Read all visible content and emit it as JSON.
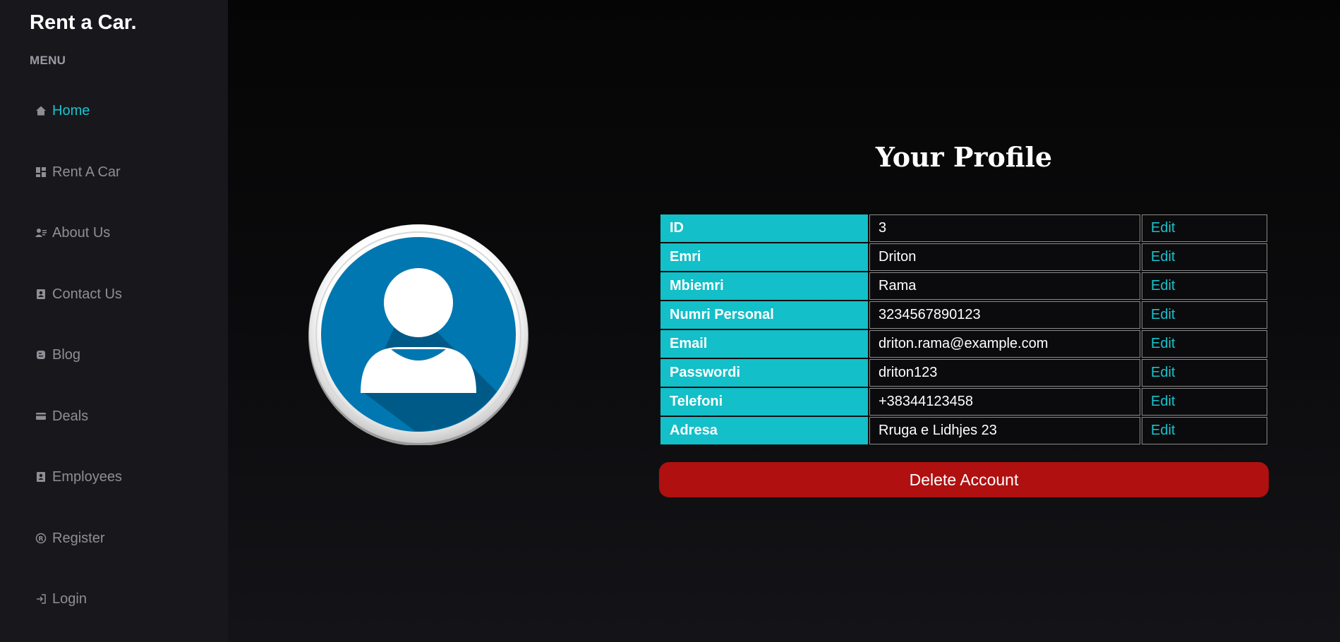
{
  "brand": "Rent a Car.",
  "menu_heading": "MENU",
  "nav": [
    {
      "label": "Home",
      "icon": "home-icon",
      "active": true
    },
    {
      "label": "Rent A Car",
      "icon": "dashboard-icon"
    },
    {
      "label": "About Us",
      "icon": "contact-card-icon"
    },
    {
      "label": "Contact Us",
      "icon": "address-book-icon"
    },
    {
      "label": "Blog",
      "icon": "blog-icon"
    },
    {
      "label": "Deals",
      "icon": "credit-card-icon"
    },
    {
      "label": "Employees",
      "icon": "badge-icon"
    },
    {
      "label": "Register",
      "icon": "registered-icon"
    },
    {
      "label": "Login",
      "icon": "login-icon"
    }
  ],
  "profile": {
    "title": "Your Profile",
    "edit_label": "Edit",
    "rows": [
      {
        "label": "ID",
        "value": "3"
      },
      {
        "label": "Emri",
        "value": "Driton"
      },
      {
        "label": "Mbiemri",
        "value": "Rama"
      },
      {
        "label": "Numri Personal",
        "value": "3234567890123"
      },
      {
        "label": "Email",
        "value": "driton.rama@example.com"
      },
      {
        "label": "Passwordi",
        "value": "driton123"
      },
      {
        "label": "Telefoni",
        "value": "+38344123458"
      },
      {
        "label": "Adresa",
        "value": "Rruga e Lidhjes 23"
      }
    ],
    "delete_label": "Delete Account"
  },
  "colors": {
    "accent": "#13bfc8",
    "danger": "#b01010",
    "sidebar_bg": "#18181c",
    "avatar_blue": "#0077b0"
  }
}
